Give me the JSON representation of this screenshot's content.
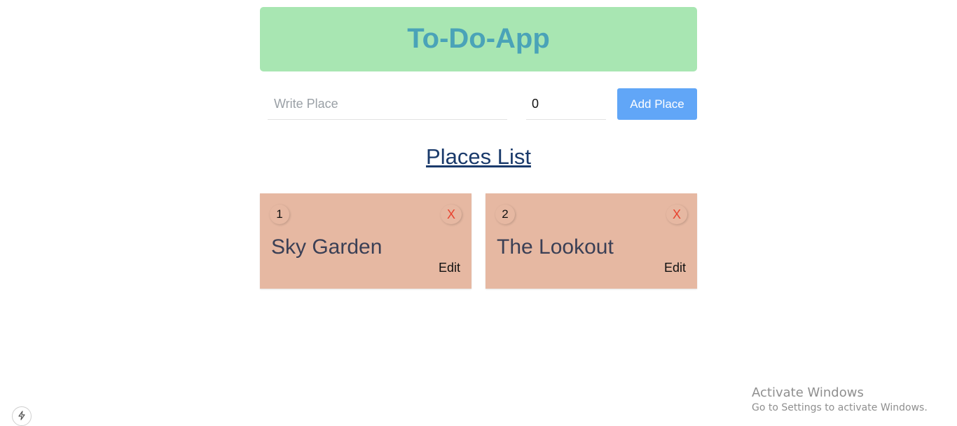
{
  "app": {
    "title": "To-Do-App"
  },
  "form": {
    "place_placeholder": "Write Place",
    "place_value": "",
    "number_value": "0",
    "add_label": "Add Place"
  },
  "list": {
    "title": "Places List",
    "items": [
      {
        "index": "1",
        "name": "Sky Garden",
        "delete_label": "X",
        "edit_label": "Edit"
      },
      {
        "index": "2",
        "name": "The Lookout",
        "delete_label": "X",
        "edit_label": "Edit"
      }
    ]
  },
  "os": {
    "activate_title": "Activate Windows",
    "activate_subtitle": "Go to Settings to activate Windows.",
    "corner_icon": "bolt-icon"
  },
  "colors": {
    "header_bg": "#a8e6b2",
    "header_text": "#4aa3b8",
    "button_bg": "#61a6f7",
    "card_bg": "#e6b8a2",
    "delete_color": "#e8432f",
    "list_title": "#1a3a6b"
  }
}
